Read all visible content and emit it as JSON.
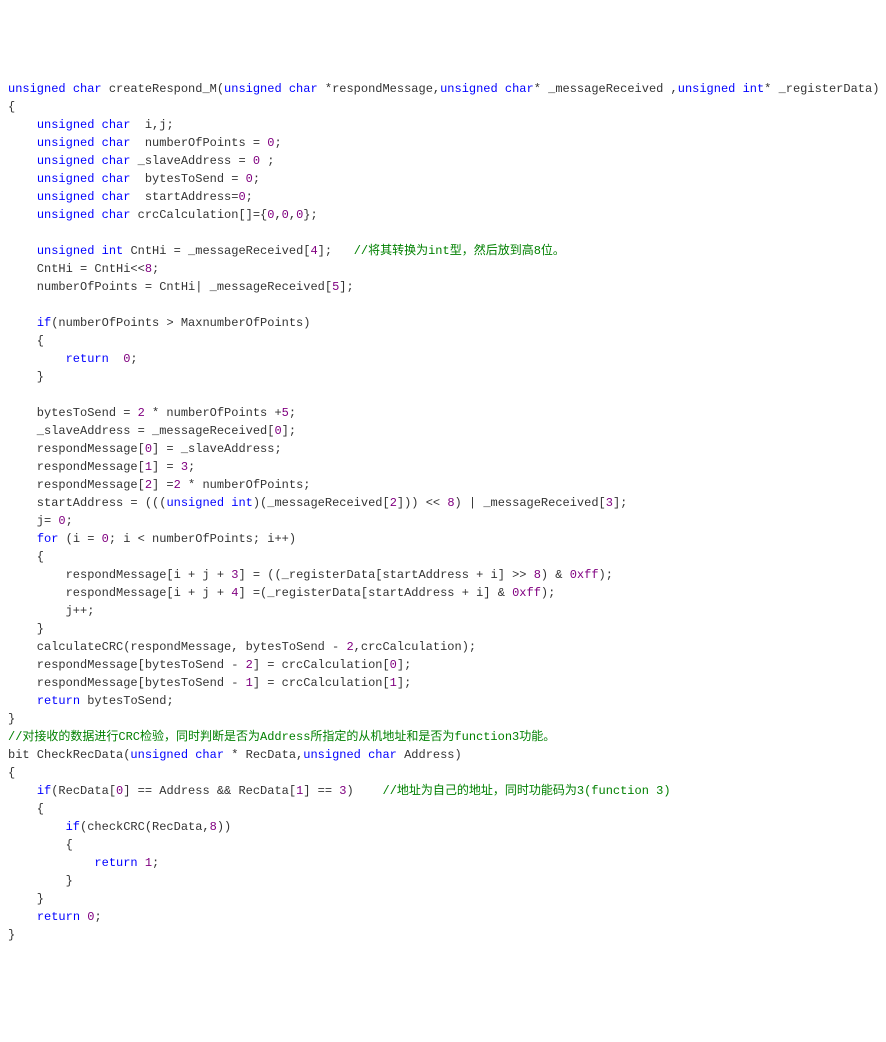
{
  "lines": [
    {
      "segs": [
        {
          "t": "unsigned ",
          "c": "kw"
        },
        {
          "t": "char ",
          "c": "type"
        },
        {
          "t": "createRespond_M("
        },
        {
          "t": "unsigned ",
          "c": "kw"
        },
        {
          "t": "char ",
          "c": "type"
        },
        {
          "t": "*respondMessage,"
        },
        {
          "t": "unsigned ",
          "c": "kw"
        },
        {
          "t": "char",
          "c": "type"
        },
        {
          "t": "* _messageReceived ,"
        },
        {
          "t": "unsigned ",
          "c": "kw"
        },
        {
          "t": "int",
          "c": "type"
        },
        {
          "t": "* _registerData)"
        }
      ]
    },
    {
      "segs": [
        {
          "t": "{"
        }
      ]
    },
    {
      "segs": [
        {
          "t": "    "
        },
        {
          "t": "unsigned ",
          "c": "kw"
        },
        {
          "t": "char  ",
          "c": "type"
        },
        {
          "t": "i,j;"
        }
      ]
    },
    {
      "segs": [
        {
          "t": "    "
        },
        {
          "t": "unsigned ",
          "c": "kw"
        },
        {
          "t": "char  ",
          "c": "type"
        },
        {
          "t": "numberOfPoints = "
        },
        {
          "t": "0",
          "c": "num"
        },
        {
          "t": ";"
        }
      ]
    },
    {
      "segs": [
        {
          "t": "    "
        },
        {
          "t": "unsigned ",
          "c": "kw"
        },
        {
          "t": "char ",
          "c": "type"
        },
        {
          "t": "_slaveAddress = "
        },
        {
          "t": "0",
          "c": "num"
        },
        {
          "t": " ;"
        }
      ]
    },
    {
      "segs": [
        {
          "t": "    "
        },
        {
          "t": "unsigned ",
          "c": "kw"
        },
        {
          "t": "char  ",
          "c": "type"
        },
        {
          "t": "bytesToSend = "
        },
        {
          "t": "0",
          "c": "num"
        },
        {
          "t": ";"
        }
      ]
    },
    {
      "segs": [
        {
          "t": "    "
        },
        {
          "t": "unsigned ",
          "c": "kw"
        },
        {
          "t": "char  ",
          "c": "type"
        },
        {
          "t": "startAddress="
        },
        {
          "t": "0",
          "c": "num"
        },
        {
          "t": ";"
        }
      ]
    },
    {
      "segs": [
        {
          "t": "    "
        },
        {
          "t": "unsigned ",
          "c": "kw"
        },
        {
          "t": "char ",
          "c": "type"
        },
        {
          "t": "crcCalculation[]={"
        },
        {
          "t": "0",
          "c": "num"
        },
        {
          "t": ","
        },
        {
          "t": "0",
          "c": "num"
        },
        {
          "t": ","
        },
        {
          "t": "0",
          "c": "num"
        },
        {
          "t": "};"
        }
      ]
    },
    {
      "segs": [
        {
          "t": " "
        }
      ]
    },
    {
      "segs": [
        {
          "t": "    "
        },
        {
          "t": "unsigned ",
          "c": "kw"
        },
        {
          "t": "int ",
          "c": "type"
        },
        {
          "t": "CntHi = _messageReceived["
        },
        {
          "t": "4",
          "c": "num"
        },
        {
          "t": "];   "
        },
        {
          "t": "//将其转换为int型，然后放到高8位。",
          "c": "comment"
        }
      ]
    },
    {
      "segs": [
        {
          "t": "    CntHi = CntHi<<"
        },
        {
          "t": "8",
          "c": "num"
        },
        {
          "t": ";"
        }
      ]
    },
    {
      "segs": [
        {
          "t": "    numberOfPoints = CntHi| _messageReceived["
        },
        {
          "t": "5",
          "c": "num"
        },
        {
          "t": "];"
        }
      ]
    },
    {
      "segs": [
        {
          "t": " "
        }
      ]
    },
    {
      "segs": [
        {
          "t": "    "
        },
        {
          "t": "if",
          "c": "kw"
        },
        {
          "t": "(numberOfPoints > MaxnumberOfPoints)"
        }
      ]
    },
    {
      "segs": [
        {
          "t": "    {"
        }
      ]
    },
    {
      "segs": [
        {
          "t": "        "
        },
        {
          "t": "return  ",
          "c": "kw"
        },
        {
          "t": "0",
          "c": "num"
        },
        {
          "t": ";"
        }
      ]
    },
    {
      "segs": [
        {
          "t": "    }"
        }
      ]
    },
    {
      "segs": [
        {
          "t": " "
        }
      ]
    },
    {
      "segs": [
        {
          "t": "    bytesToSend = "
        },
        {
          "t": "2",
          "c": "num"
        },
        {
          "t": " * numberOfPoints +"
        },
        {
          "t": "5",
          "c": "num"
        },
        {
          "t": ";"
        }
      ]
    },
    {
      "segs": [
        {
          "t": "    _slaveAddress = _messageReceived["
        },
        {
          "t": "0",
          "c": "num"
        },
        {
          "t": "];"
        }
      ]
    },
    {
      "segs": [
        {
          "t": "    respondMessage["
        },
        {
          "t": "0",
          "c": "num"
        },
        {
          "t": "] = _slaveAddress;"
        }
      ]
    },
    {
      "segs": [
        {
          "t": "    respondMessage["
        },
        {
          "t": "1",
          "c": "num"
        },
        {
          "t": "] = "
        },
        {
          "t": "3",
          "c": "num"
        },
        {
          "t": ";"
        }
      ]
    },
    {
      "segs": [
        {
          "t": "    respondMessage["
        },
        {
          "t": "2",
          "c": "num"
        },
        {
          "t": "] ="
        },
        {
          "t": "2",
          "c": "num"
        },
        {
          "t": " * numberOfPoints;"
        }
      ]
    },
    {
      "segs": [
        {
          "t": "    startAddress = ((("
        },
        {
          "t": "unsigned ",
          "c": "kw"
        },
        {
          "t": "int",
          "c": "type"
        },
        {
          "t": ")(_messageReceived["
        },
        {
          "t": "2",
          "c": "num"
        },
        {
          "t": "])) << "
        },
        {
          "t": "8",
          "c": "num"
        },
        {
          "t": ") | _messageReceived["
        },
        {
          "t": "3",
          "c": "num"
        },
        {
          "t": "];"
        }
      ]
    },
    {
      "segs": [
        {
          "t": "    j= "
        },
        {
          "t": "0",
          "c": "num"
        },
        {
          "t": ";"
        }
      ]
    },
    {
      "segs": [
        {
          "t": "    "
        },
        {
          "t": "for ",
          "c": "kw"
        },
        {
          "t": "(i = "
        },
        {
          "t": "0",
          "c": "num"
        },
        {
          "t": "; i < numberOfPoints; i++)"
        }
      ]
    },
    {
      "segs": [
        {
          "t": "    {"
        }
      ]
    },
    {
      "segs": [
        {
          "t": "        respondMessage[i + j + "
        },
        {
          "t": "3",
          "c": "num"
        },
        {
          "t": "] = ((_registerData[startAddress + i] >> "
        },
        {
          "t": "8",
          "c": "num"
        },
        {
          "t": ") & "
        },
        {
          "t": "0xff",
          "c": "num"
        },
        {
          "t": ");"
        }
      ]
    },
    {
      "segs": [
        {
          "t": "        respondMessage[i + j + "
        },
        {
          "t": "4",
          "c": "num"
        },
        {
          "t": "] =(_registerData[startAddress + i] & "
        },
        {
          "t": "0xff",
          "c": "num"
        },
        {
          "t": ");"
        }
      ]
    },
    {
      "segs": [
        {
          "t": "        j++;"
        }
      ]
    },
    {
      "segs": [
        {
          "t": "    }"
        }
      ]
    },
    {
      "segs": [
        {
          "t": "    calculateCRC(respondMessage, bytesToSend - "
        },
        {
          "t": "2",
          "c": "num"
        },
        {
          "t": ",crcCalculation);"
        }
      ]
    },
    {
      "segs": [
        {
          "t": "    respondMessage[bytesToSend - "
        },
        {
          "t": "2",
          "c": "num"
        },
        {
          "t": "] = crcCalculation["
        },
        {
          "t": "0",
          "c": "num"
        },
        {
          "t": "];"
        }
      ]
    },
    {
      "segs": [
        {
          "t": "    respondMessage[bytesToSend - "
        },
        {
          "t": "1",
          "c": "num"
        },
        {
          "t": "] = crcCalculation["
        },
        {
          "t": "1",
          "c": "num"
        },
        {
          "t": "];"
        }
      ]
    },
    {
      "segs": [
        {
          "t": "    "
        },
        {
          "t": "return ",
          "c": "kw"
        },
        {
          "t": "bytesToSend;"
        }
      ]
    },
    {
      "segs": [
        {
          "t": "}"
        }
      ]
    },
    {
      "segs": [
        {
          "t": "//对接收的数据进行CRC检验，同时判断是否为Address所指定的从机地址和是否为function3功能。",
          "c": "comment"
        }
      ]
    },
    {
      "segs": [
        {
          "t": "bit CheckRecData("
        },
        {
          "t": "unsigned ",
          "c": "kw"
        },
        {
          "t": "char ",
          "c": "type"
        },
        {
          "t": "* RecData,"
        },
        {
          "t": "unsigned ",
          "c": "kw"
        },
        {
          "t": "char ",
          "c": "type"
        },
        {
          "t": "Address)"
        }
      ]
    },
    {
      "segs": [
        {
          "t": "{"
        }
      ]
    },
    {
      "segs": [
        {
          "t": "    "
        },
        {
          "t": "if",
          "c": "kw"
        },
        {
          "t": "(RecData["
        },
        {
          "t": "0",
          "c": "num"
        },
        {
          "t": "] == Address && RecData["
        },
        {
          "t": "1",
          "c": "num"
        },
        {
          "t": "] == "
        },
        {
          "t": "3",
          "c": "num"
        },
        {
          "t": ")    "
        },
        {
          "t": "//地址为自己的地址，同时功能码为3(function 3)",
          "c": "comment"
        }
      ]
    },
    {
      "segs": [
        {
          "t": "    {"
        }
      ]
    },
    {
      "segs": [
        {
          "t": "        "
        },
        {
          "t": "if",
          "c": "kw"
        },
        {
          "t": "(checkCRC(RecData,"
        },
        {
          "t": "8",
          "c": "num"
        },
        {
          "t": "))"
        }
      ]
    },
    {
      "segs": [
        {
          "t": "        {"
        }
      ]
    },
    {
      "segs": [
        {
          "t": "            "
        },
        {
          "t": "return ",
          "c": "kw"
        },
        {
          "t": "1",
          "c": "num"
        },
        {
          "t": ";"
        }
      ]
    },
    {
      "segs": [
        {
          "t": "        }"
        }
      ]
    },
    {
      "segs": [
        {
          "t": "    }"
        }
      ]
    },
    {
      "segs": [
        {
          "t": "    "
        },
        {
          "t": "return ",
          "c": "kw"
        },
        {
          "t": "0",
          "c": "num"
        },
        {
          "t": ";"
        }
      ]
    },
    {
      "segs": [
        {
          "t": "}"
        }
      ]
    }
  ]
}
